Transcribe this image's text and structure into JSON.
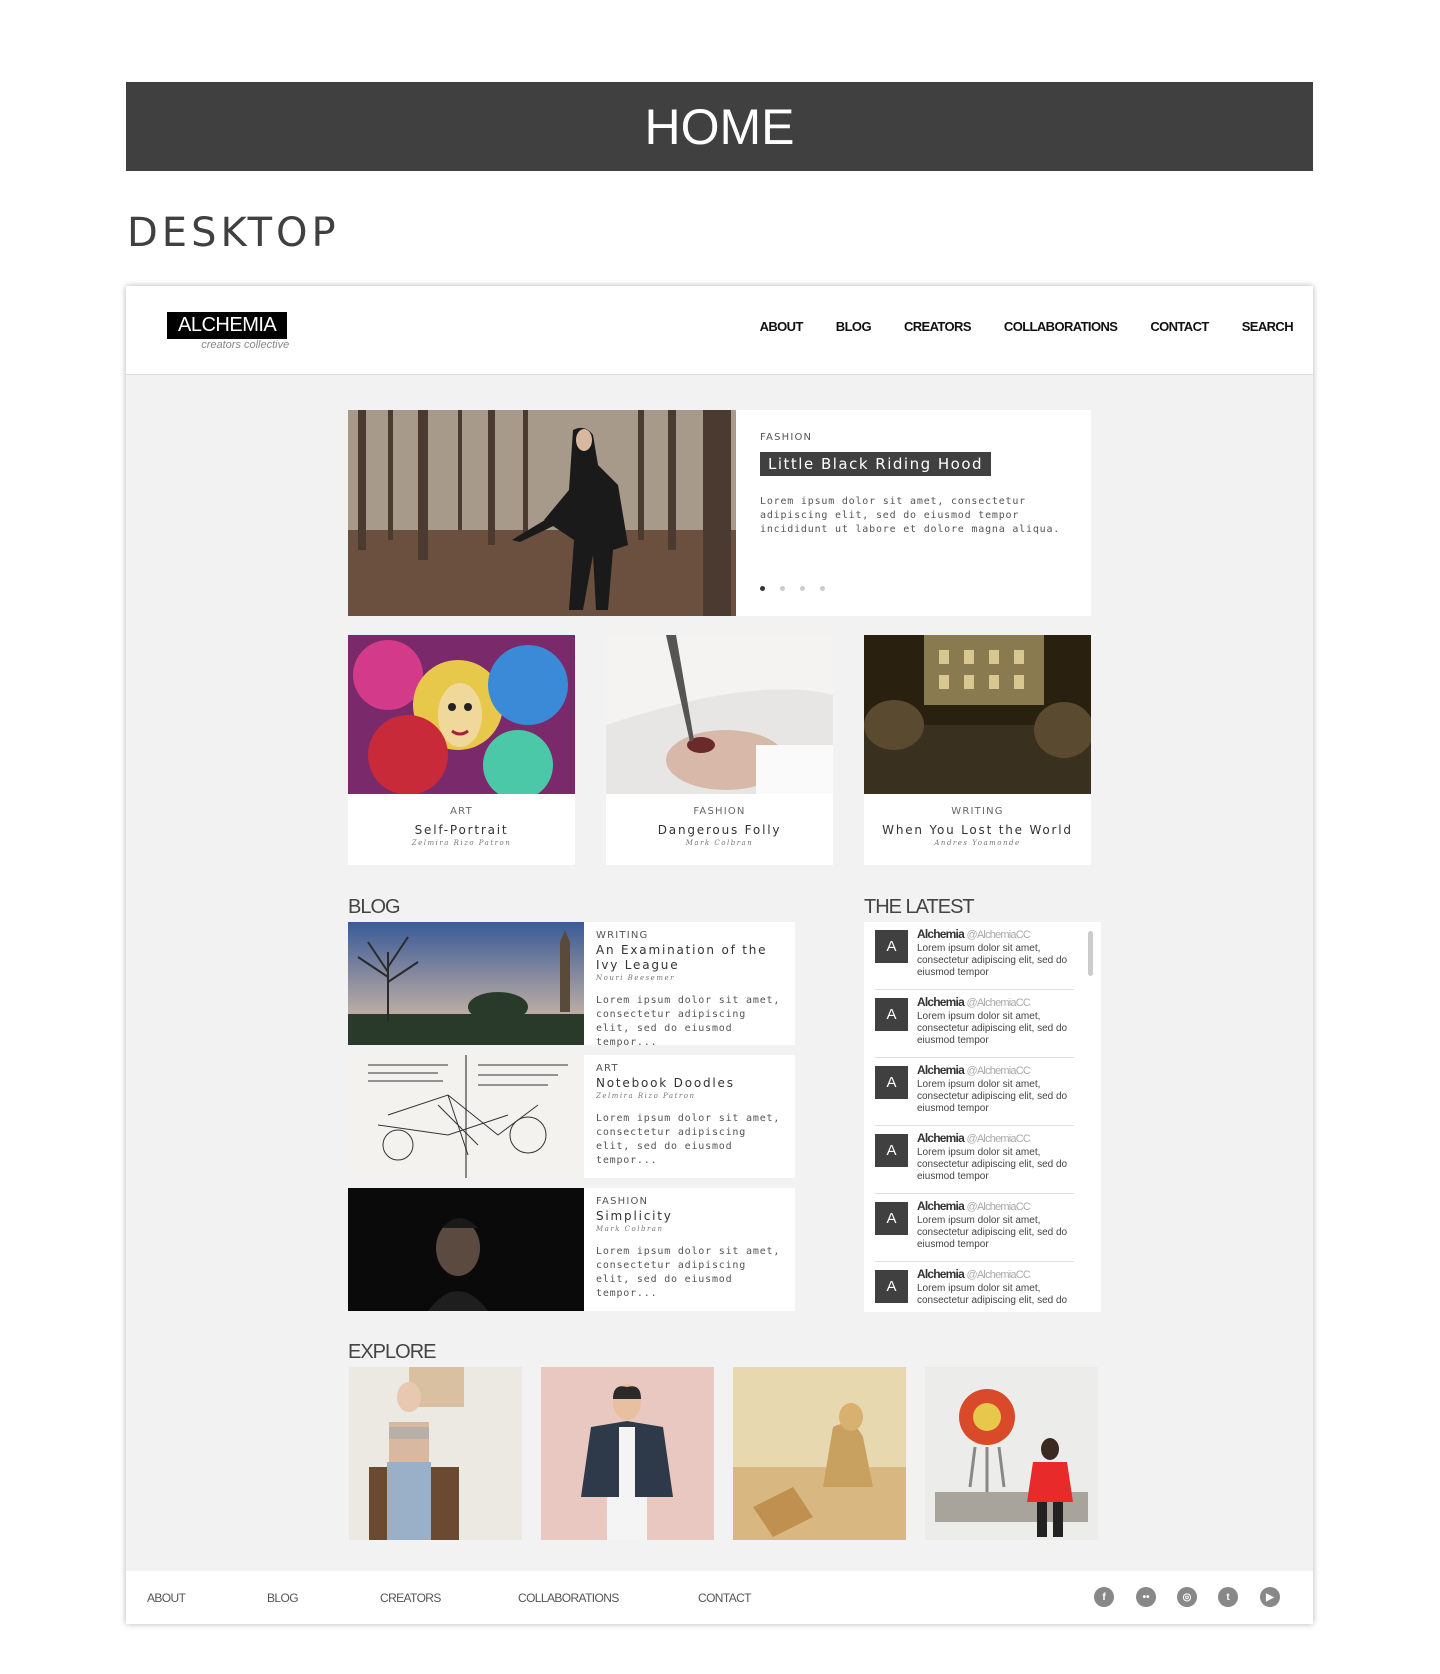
{
  "banner": {
    "title": "HOME"
  },
  "view_label": "DESKTOP",
  "site": {
    "logo": "ALCHEMIA",
    "logo_sub": "creators collective",
    "nav": [
      "ABOUT",
      "BLOG",
      "CREATORS",
      "COLLABORATIONS",
      "CONTACT",
      "SEARCH"
    ]
  },
  "hero": {
    "category": "FASHION",
    "title": "Little Black Riding Hood",
    "description": "Lorem ipsum dolor sit amet, consectetur adipiscing elit, sed do eiusmod tempor incididunt ut labore et dolore magna aliqua.",
    "slides": 4,
    "active_slide": 1
  },
  "cards": [
    {
      "category": "ART",
      "title": "Self-Portrait",
      "author": "Zelmira Rizo Patron"
    },
    {
      "category": "FASHION",
      "title": "Dangerous Folly",
      "author": "Mark Colbran"
    },
    {
      "category": "WRITING",
      "title": "When You Lost the World",
      "author": "Andres Yoamonde"
    }
  ],
  "blog": {
    "heading": "BLOG",
    "items": [
      {
        "category": "WRITING",
        "title": "An Examination of the Ivy League",
        "author": "Nouri Beesemer",
        "excerpt": "Lorem ipsum dolor sit amet, consectetur adipiscing elit, sed do eiusmod tempor..."
      },
      {
        "category": "ART",
        "title": "Notebook Doodles",
        "author": "Zelmira Rizo Patron",
        "excerpt": "Lorem ipsum dolor sit amet, consectetur adipiscing elit, sed do eiusmod tempor..."
      },
      {
        "category": "FASHION",
        "title": "Simplicity",
        "author": "Mark Colbran",
        "excerpt": "Lorem ipsum dolor sit amet, consectetur adipiscing elit, sed do eiusmod tempor..."
      }
    ]
  },
  "latest": {
    "heading": "THE LATEST",
    "tweets": [
      {
        "avatar": "A",
        "name": "Alchemia",
        "handle": "@AlchemiaCC",
        "text": "Lorem ipsum dolor sit amet, consectetur adipiscing elit, sed do eiusmod tempor"
      },
      {
        "avatar": "A",
        "name": "Alchemia",
        "handle": "@AlchemiaCC",
        "text": "Lorem ipsum dolor sit amet, consectetur adipiscing elit, sed do eiusmod tempor"
      },
      {
        "avatar": "A",
        "name": "Alchemia",
        "handle": "@AlchemiaCC",
        "text": "Lorem ipsum dolor sit amet, consectetur adipiscing elit, sed do eiusmod tempor"
      },
      {
        "avatar": "A",
        "name": "Alchemia",
        "handle": "@AlchemiaCC",
        "text": "Lorem ipsum dolor sit amet, consectetur adipiscing elit, sed do eiusmod tempor"
      },
      {
        "avatar": "A",
        "name": "Alchemia",
        "handle": "@AlchemiaCC",
        "text": "Lorem ipsum dolor sit amet, consectetur adipiscing elit, sed do eiusmod tempor"
      },
      {
        "avatar": "A",
        "name": "Alchemia",
        "handle": "@AlchemiaCC",
        "text": "Lorem ipsum dolor sit amet, consectetur adipiscing elit, sed do"
      }
    ]
  },
  "explore": {
    "heading": "EXPLORE"
  },
  "footer": {
    "nav": [
      "ABOUT",
      "BLOG",
      "CREATORS",
      "COLLABORATIONS",
      "CONTACT"
    ],
    "social": [
      {
        "icon": "facebook-icon",
        "glyph": "f"
      },
      {
        "icon": "flickr-icon",
        "glyph": "••"
      },
      {
        "icon": "instagram-icon",
        "glyph": "◎"
      },
      {
        "icon": "twitter-icon",
        "glyph": "t"
      },
      {
        "icon": "youtube-icon",
        "glyph": "▶"
      }
    ]
  },
  "colors": {
    "dark": "#404040",
    "background": "#f2f2f2",
    "panel": "#ffffff"
  }
}
